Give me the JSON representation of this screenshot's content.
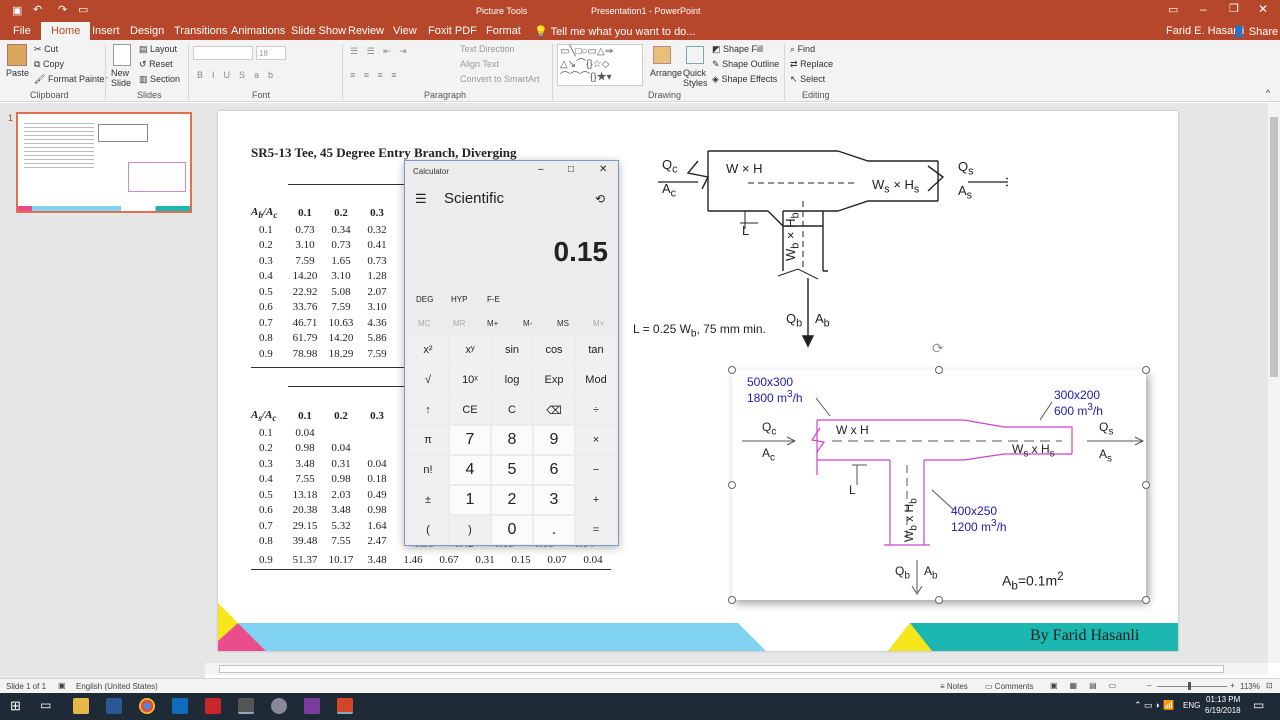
{
  "window": {
    "filename_title": "Presentation1 - PowerPoint",
    "context_tab": "Picture Tools",
    "user": "Farid E. Hasanli",
    "share": "Share"
  },
  "tabs": [
    "File",
    "Home",
    "Insert",
    "Design",
    "Transitions",
    "Animations",
    "Slide Show",
    "Review",
    "View",
    "Foxit PDF",
    "Format"
  ],
  "tell_me": "Tell me what you want to do...",
  "ribbon": {
    "paste": "Paste",
    "cut": "Cut",
    "copy": "Copy",
    "format_painter": "Format Painter",
    "new_slide": "New Slide",
    "layout": "Layout",
    "reset": "Reset",
    "section": "Section",
    "font_size": "18",
    "text_direction": "Text Direction",
    "align_text": "Align Text",
    "convert_smartart": "Convert to SmartArt",
    "arrange": "Arrange",
    "quick_styles": "Quick Styles",
    "shape_fill": "Shape Fill",
    "shape_outline": "Shape Outline",
    "shape_effects": "Shape Effects",
    "find": "Find",
    "replace": "Replace",
    "select": "Select",
    "groups": [
      "Clipboard",
      "Slides",
      "Font",
      "Paragraph",
      "Drawing",
      "Editing"
    ]
  },
  "slide_number": "1",
  "slide": {
    "title": "SR5-13 Tee, 45 Degree Entry Branch, Diverging",
    "table1": {
      "header": [
        "Ab/Ac",
        "0.1",
        "0.2",
        "0.3"
      ],
      "rows": [
        [
          "0.1",
          "0.73",
          "0.34",
          "0.32"
        ],
        [
          "0.2",
          "3.10",
          "0.73",
          "0.41"
        ],
        [
          "0.3",
          "7.59",
          "1.65",
          "0.73"
        ],
        [
          "0.4",
          "14.20",
          "3.10",
          "1.28"
        ],
        [
          "0.5",
          "22.92",
          "5.08",
          "2.07"
        ],
        [
          "0.6",
          "33.76",
          "7.59",
          "3.10"
        ],
        [
          "0.7",
          "46.71",
          "10.63",
          "4.36"
        ],
        [
          "0.8",
          "61.79",
          "14.20",
          "5.86"
        ],
        [
          "0.9",
          "78.98",
          "18.29",
          "7.59"
        ]
      ]
    },
    "table2": {
      "header": [
        "As/Ac",
        "0.1",
        "0.2",
        "0.3"
      ],
      "rows": [
        [
          "0.1",
          "0.04",
          "",
          ""
        ],
        [
          "0.2",
          "0.98",
          "0.04",
          ""
        ],
        [
          "0.3",
          "3.48",
          "0.31",
          "0.04"
        ],
        [
          "0.4",
          "7.55",
          "0.98",
          "0.18"
        ],
        [
          "0.5",
          "13.18",
          "2.03",
          "0.49"
        ],
        [
          "0.6",
          "20.38",
          "3.48",
          "0.98"
        ],
        [
          "0.7",
          "29.15",
          "5.32",
          "1.64"
        ],
        [
          "0.8",
          "39.48",
          "7.55",
          "2.47"
        ]
      ],
      "partial_row_08": [
        "0.98",
        "0.42",
        "0.18",
        "0.08",
        "0.04"
      ],
      "last_row": [
        "0.9",
        "51.37",
        "10.17",
        "3.48",
        "1.46",
        "0.67",
        "0.31",
        "0.15",
        "0.07",
        "0.04"
      ]
    },
    "diagram1": {
      "qc": "Q",
      "qc_sub": "c",
      "ac": "A",
      "ac_sub": "c",
      "wh": "W × H",
      "ws": "W",
      "ws_sub": "s",
      "x": " × H",
      "hs_sub": "s",
      "qs": "Q",
      "qs_sub": "s",
      "as": "A",
      "as_sub": "s",
      "l": "L",
      "wb": "W",
      "wb_sub": "b",
      "xh": " × H",
      "hb_sub": "b",
      "qb": "Q",
      "qb_sub": "b",
      "ab": "A",
      "ab_sub": "b",
      "note": "L = 0.25 W",
      "note_sub": "b",
      "note_end": ", 75 mm min."
    },
    "diagram2": {
      "main_size": "500x300",
      "main_flow": "1800 m",
      "main_flow_unit": "/h",
      "main_sup": "3",
      "side_size": "300x200",
      "side_flow": "600 m",
      "side_flow_unit": "/h",
      "branch_size": "400x250",
      "branch_flow": "1200 m",
      "branch_flow_unit": "/h",
      "qc": "Q",
      "c": "c",
      "ac": "A",
      "wh": "W x H",
      "ws": "W",
      "s": "s",
      "x": " x H",
      "qs": "Q",
      "as": "A",
      "l": "L",
      "wb": "W",
      "b": "b",
      "xh": " x H",
      "qb": "Q",
      "ab": "A",
      "area": "A",
      "area_eq": "=0.1m",
      "area_sup": "2"
    },
    "footer": "By Farid Hasanli"
  },
  "calculator": {
    "title": "Calculator",
    "mode": "Scientific",
    "display": "0.15",
    "modes": [
      "DEG",
      "HYP",
      "F-E"
    ],
    "memory": [
      "MC",
      "MR",
      "M+",
      "M-",
      "MS",
      "M˅"
    ],
    "keys": [
      [
        "x²",
        "xʸ",
        "sin",
        "cos",
        "tan"
      ],
      [
        "√",
        "10ˣ",
        "log",
        "Exp",
        "Mod"
      ],
      [
        "↑",
        "CE",
        "C",
        "⌫",
        "÷"
      ],
      [
        "π",
        "7",
        "8",
        "9",
        "×"
      ],
      [
        "n!",
        "4",
        "5",
        "6",
        "−"
      ],
      [
        "±",
        "1",
        "2",
        "3",
        "+"
      ],
      [
        "(",
        ")",
        "0",
        ".",
        "="
      ]
    ]
  },
  "status": {
    "slide": "Slide 1 of 1",
    "language": "English (United States)",
    "notes": "Notes",
    "comments": "Comments",
    "zoom": "113%"
  },
  "taskbar": {
    "lang": "ENG",
    "time": "01:13 PM",
    "date": "6/19/2018"
  },
  "colors": {
    "accent": "#b7472a",
    "pink": "#e94d8c",
    "cyan": "#7fd3f0",
    "teal": "#1bb7b0",
    "yellow": "#f5e71b",
    "blue_label": "#1c1ca8",
    "magenta_line": "#cc55cc"
  }
}
